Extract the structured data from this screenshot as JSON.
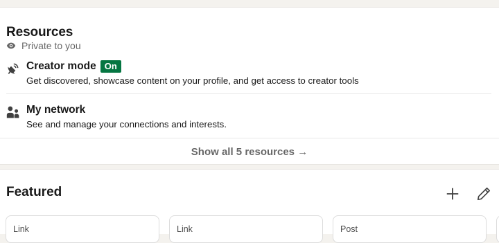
{
  "resources": {
    "title": "Resources",
    "visibility": "Private to you",
    "items": [
      {
        "title": "Creator mode",
        "badge": "On",
        "description": "Get discovered, showcase content on your profile, and get access to creator tools",
        "icon": "satellite-dish-icon"
      },
      {
        "title": "My network",
        "description": "See and manage your connections and interests.",
        "icon": "people-icon"
      }
    ],
    "show_all_label": "Show all 5 resources →"
  },
  "featured": {
    "title": "Featured",
    "cards": [
      {
        "type": "Link"
      },
      {
        "type": "Link"
      },
      {
        "type": "Post"
      }
    ]
  },
  "colors": {
    "badge_green": "#057642",
    "page_bg": "#f4f2ee"
  }
}
